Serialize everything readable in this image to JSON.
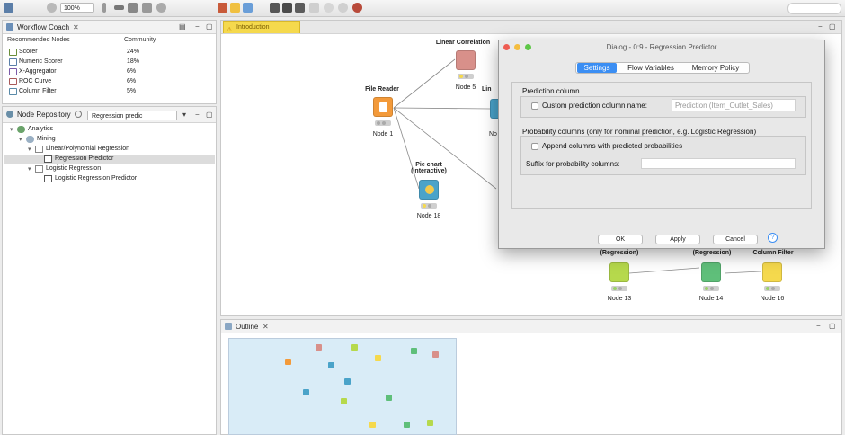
{
  "toolbar": {
    "zoom": "100%"
  },
  "coach": {
    "title": "Workflow Coach",
    "col_nodes": "Recommended Nodes",
    "col_community": "Community",
    "rows": [
      {
        "name": "Scorer",
        "pct": "24%"
      },
      {
        "name": "Numeric Scorer",
        "pct": "18%"
      },
      {
        "name": "X-Aggregator",
        "pct": "6%"
      },
      {
        "name": "ROC Curve",
        "pct": "6%"
      },
      {
        "name": "Column Filter",
        "pct": "5%"
      }
    ]
  },
  "repository": {
    "title": "Node Repository",
    "search_value": "Regression predic",
    "tree": [
      {
        "label": "Analytics",
        "indent": 0
      },
      {
        "label": "Mining",
        "indent": 1
      },
      {
        "label": "Linear/Polynomial Regression",
        "indent": 2
      },
      {
        "label": "Regression Predictor",
        "indent": 3
      },
      {
        "label": "Logistic Regression",
        "indent": 2
      },
      {
        "label": "Logistic Regression Predictor",
        "indent": 3
      }
    ]
  },
  "editor": {
    "tab_label": "Introduction",
    "nodes": {
      "file_reader": {
        "title": "File Reader",
        "label": "Node 1",
        "color": "#f39a3a"
      },
      "linear_corr": {
        "title": "Linear Correlation",
        "label": "Node 5",
        "color": "#d8908a"
      },
      "lin_partial": {
        "title": "Lin",
        "label": "No",
        "color": "#4aa3c9"
      },
      "pie_chart": {
        "title": "Pie chart (Interactive)",
        "label": "Node 18",
        "color": "#4aa3c9"
      },
      "node13": {
        "title": "(Regression)",
        "label": "Node 13",
        "color": "#b6d94c"
      },
      "node14": {
        "title": "(Regression)",
        "label": "Node 14",
        "color": "#5fbf7a"
      },
      "node16": {
        "title": "Column Filter",
        "label": "Node 16",
        "color": "#f5d94d"
      }
    }
  },
  "dialog": {
    "title": "Dialog - 0:9 - Regression Predictor",
    "tabs": [
      "Settings",
      "Flow Variables",
      "Memory Policy"
    ],
    "active_tab": 0,
    "group1_title": "Prediction column",
    "custom_name_label": "Custom prediction column name:",
    "custom_name_value": "Prediction (Item_Outlet_Sales)",
    "group2_title": "Probability columns (only for nominal prediction, e.g. Logistic Regression)",
    "append_label": "Append columns with predicted probabilities",
    "suffix_label": "Suffix for probability columns:",
    "suffix_value": "",
    "buttons": {
      "ok": "OK",
      "apply": "Apply",
      "cancel": "Cancel",
      "help": "?"
    }
  },
  "outline": {
    "title": "Outline"
  },
  "colors": {
    "accent": "#3b8ef3",
    "editor_tab": "#f5d94d",
    "selection": "#dcdcdc"
  }
}
